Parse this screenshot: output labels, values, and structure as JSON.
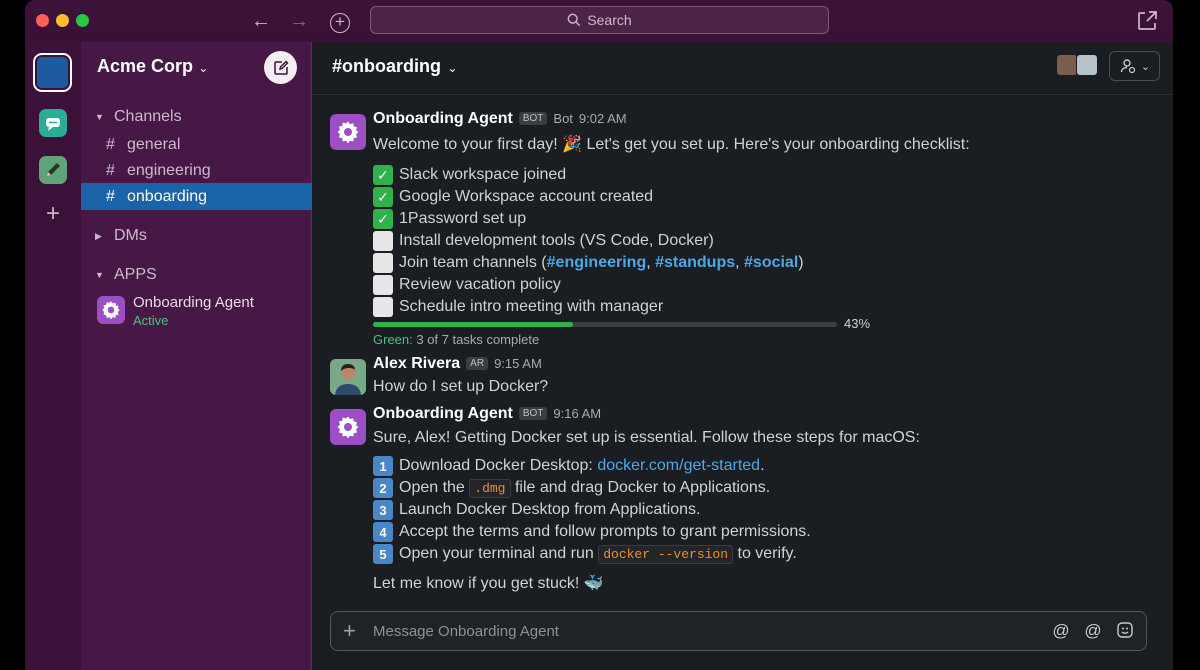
{
  "titlebar": {
    "search_label": "Search"
  },
  "sidebar": {
    "workspace_name": "Acme Corp",
    "sections": {
      "channels": "Channels",
      "dms": "DMs",
      "apps": "APPS"
    },
    "channels": [
      {
        "hash": "#",
        "name": "general"
      },
      {
        "hash": "#",
        "name": "engineering"
      },
      {
        "hash": "#",
        "name": "onboarding",
        "active": true
      }
    ],
    "app": {
      "name": "Onboarding Agent",
      "status": "Active"
    }
  },
  "channel": {
    "title": "#onboarding"
  },
  "messages": [
    {
      "sender": "Onboarding Agent",
      "tag": "BOT",
      "tag_label": "Bot",
      "time": "9:02 AM",
      "intro_before": "Welcome to your first day! ",
      "intro_emoji": "🎉",
      "intro_after": " Let's get you set up. Here's your onboarding checklist:",
      "checklist": [
        {
          "done": true,
          "text": "Slack workspace joined"
        },
        {
          "done": true,
          "text": "Google Workspace account created"
        },
        {
          "done": true,
          "text": "1Password set up"
        },
        {
          "done": false,
          "text": "Install development tools (VS Code, Docker)"
        },
        {
          "done": false,
          "text_before": "Join team channels (",
          "links": [
            "#engineering",
            "#standups",
            "#social"
          ],
          "text_after": ")"
        },
        {
          "done": false,
          "text": "Review vacation policy"
        },
        {
          "done": false,
          "text": "Schedule intro meeting with manager"
        }
      ],
      "progress": {
        "value": 0.43,
        "label": "43%",
        "caption_green": "Green:",
        "caption_rest": " 3 of 7 tasks complete"
      }
    },
    {
      "sender": "Alex Rivera",
      "tag": "AR",
      "time": "9:15 AM",
      "text": "How do I set up Docker?"
    },
    {
      "sender": "Onboarding Agent",
      "tag": "BOT",
      "time": "9:16 AM",
      "text": "Sure, Alex! Getting Docker set up is essential. Follow these steps for macOS:",
      "steps": [
        {
          "num": "1",
          "before": "Download Docker Desktop: ",
          "link": "docker.com/get-started",
          "after": "."
        },
        {
          "num": "2",
          "before": "Open the ",
          "code": ".dmg",
          "after": " file and drag Docker to Applications."
        },
        {
          "num": "3",
          "before": "Launch Docker Desktop from Applications."
        },
        {
          "num": "4",
          "before": "Accept the terms and follow prompts to grant permissions."
        },
        {
          "num": "5",
          "before": "Open your terminal and run ",
          "code": "docker --version",
          "after": " to verify."
        }
      ],
      "closing": "Let me know if you get stuck! ",
      "closing_emoji": "🐳"
    }
  ],
  "composer": {
    "placeholder": "Message Onboarding Agent"
  },
  "colors": {
    "sidebar_bg": "#471845",
    "active_channel": "#1a63a8",
    "main_bg": "#1a1d21",
    "progress_green": "#2fb14b",
    "link_blue": "#4fa8e6",
    "code_orange": "#e8912d",
    "bot_purple": "#9b4fc2"
  }
}
